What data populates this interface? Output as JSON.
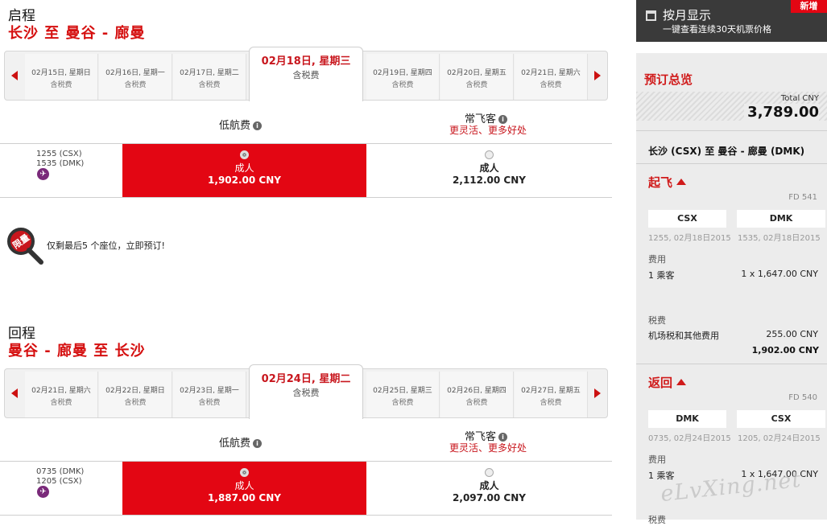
{
  "outbound": {
    "section_title": "启程",
    "route_title": "长沙  至  曼谷 - 廊曼",
    "dates": [
      {
        "date": "02月15日, 星期日",
        "tax": "含税费"
      },
      {
        "date": "02月16日, 星期一",
        "tax": "含税费"
      },
      {
        "date": "02月17日, 星期二",
        "tax": "含税费"
      },
      {
        "date": "02月19日, 星期四",
        "tax": "含税费"
      },
      {
        "date": "02月20日, 星期五",
        "tax": "含税费"
      },
      {
        "date": "02月21日, 星期六",
        "tax": "含税费"
      }
    ],
    "selected_date": {
      "date": "02月18日, 星期三",
      "tax": "含税费"
    },
    "fare_low_label": "低航费",
    "fare_flex_label": "常飞客",
    "fare_flex_perk": "更灵活、更多好处",
    "flight": {
      "depart": "1255  (CSX)",
      "arrive": "1535  (DMK)",
      "low_pax": "成人",
      "low_price": "1,902.00 CNY",
      "flex_pax": "成人",
      "flex_price": "2,112.00 CNY"
    },
    "seat_badge": "限量",
    "seat_notice": "仅剩最后5 个座位，立即预订!"
  },
  "return": {
    "section_title": "回程",
    "route_title": "曼谷 - 廊曼  至  长沙",
    "dates": [
      {
        "date": "02月21日, 星期六",
        "tax": "含税费"
      },
      {
        "date": "02月22日, 星期日",
        "tax": "含税费"
      },
      {
        "date": "02月23日, 星期一",
        "tax": "含税费"
      },
      {
        "date": "02月25日, 星期三",
        "tax": "含税费"
      },
      {
        "date": "02月26日, 星期四",
        "tax": "含税费"
      },
      {
        "date": "02月27日, 星期五",
        "tax": "含税费"
      }
    ],
    "selected_date": {
      "date": "02月24日, 星期二",
      "tax": "含税费"
    },
    "fare_low_label": "低航费",
    "fare_flex_label": "常飞客",
    "fare_flex_perk": "更灵活、更多好处",
    "flight": {
      "depart": "0735  (DMK)",
      "arrive": "1205  (CSX)",
      "low_pax": "成人",
      "low_price": "1,887.00 CNY",
      "flex_pax": "成人",
      "flex_price": "2,097.00 CNY"
    }
  },
  "monthly": {
    "title": "按月显示",
    "subtitle": "一键查看连续30天机票价格",
    "new_badge": "新增"
  },
  "summary": {
    "title": "预订总览",
    "total_label": "Total CNY",
    "total_value": "3,789.00",
    "route": "长沙 (CSX) 至 曼谷 - 廊曼 (DMK)",
    "depart": {
      "heading": "起飞",
      "flight_no": "FD 541",
      "from": "CSX",
      "to": "DMK",
      "from_time": "1255, 02月18日2015",
      "to_time": "1535, 02月18日2015",
      "fare_label": "费用",
      "pax": "1 乘客",
      "pax_fare": "1 x 1,647.00 CNY",
      "tax_label": "税费",
      "tax_name": "机场税和其他费用",
      "tax_value": "255.00 CNY",
      "subtotal": "1,902.00 CNY"
    },
    "return": {
      "heading": "返回",
      "flight_no": "FD 540",
      "from": "DMK",
      "to": "CSX",
      "from_time": "0735, 02月24日2015",
      "to_time": "1205, 02月24日2015",
      "fare_label": "费用",
      "pax": "1 乘客",
      "pax_fare": "1 x 1,647.00 CNY",
      "tax_label": "税费"
    }
  },
  "watermark": "eLvXing.net",
  "colors": {
    "brand_red": "#e30613",
    "panel_bg": "#ececec",
    "dark_bar": "#3a3a3a"
  }
}
